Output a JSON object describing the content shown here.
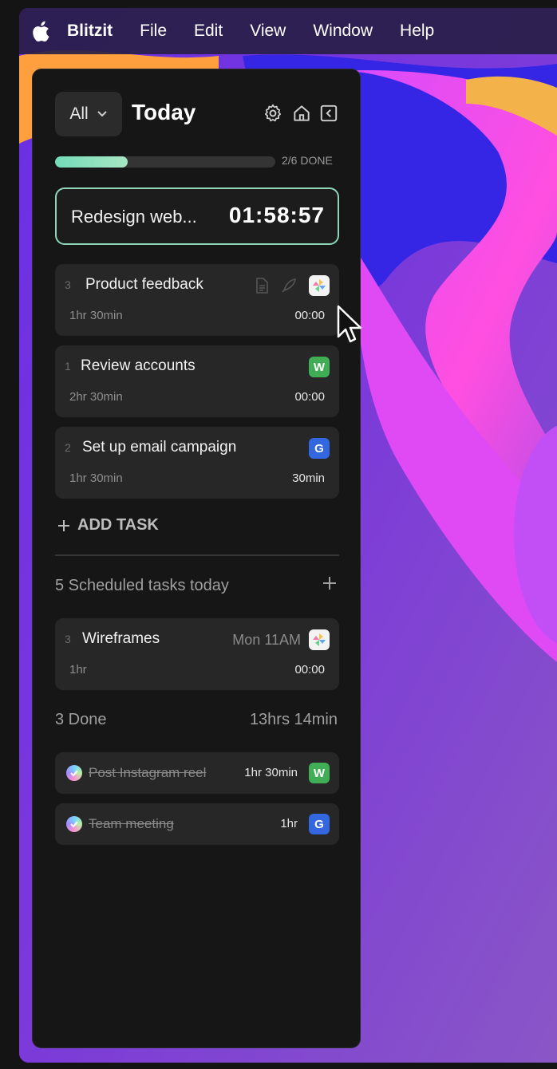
{
  "menubar": {
    "app_name": "Blitzit",
    "items": [
      "File",
      "Edit",
      "View",
      "Window",
      "Help"
    ]
  },
  "header": {
    "filter_label": "All",
    "title": "Today"
  },
  "progress": {
    "fraction_done": 0.33,
    "label": "2/6 DONE"
  },
  "current_task": {
    "title": "Redesign web...",
    "timer": "01:58:57"
  },
  "tasks": [
    {
      "num": "3",
      "title": "Product feedback",
      "duration": "1hr 30min",
      "time": "00:00",
      "badge": "pinwheel"
    },
    {
      "num": "1",
      "title": "Review accounts",
      "duration": "2hr 30min",
      "time": "00:00",
      "badge": "W"
    },
    {
      "num": "2",
      "title": "Set up email campaign",
      "duration": "1hr 30min",
      "time": "30min",
      "badge": "G"
    }
  ],
  "add_task_label": "ADD TASK",
  "scheduled": {
    "label": "5 Scheduled tasks today",
    "items": [
      {
        "num": "3",
        "title": "Wireframes",
        "when": "Mon 11AM",
        "duration": "1hr",
        "time": "00:00",
        "badge": "pinwheel"
      }
    ]
  },
  "done": {
    "label": "3 Done",
    "total": "13hrs 14min",
    "items": [
      {
        "title": "Post Instagram reel",
        "duration": "1hr 30min",
        "badge": "W"
      },
      {
        "title": "Team meeting",
        "duration": "1hr",
        "badge": "G"
      }
    ]
  },
  "colors": {
    "accent": "#8fd6b9",
    "panel": "#161616",
    "card": "#272727",
    "badge_w": "#3fae55",
    "badge_g": "#3367e0"
  }
}
